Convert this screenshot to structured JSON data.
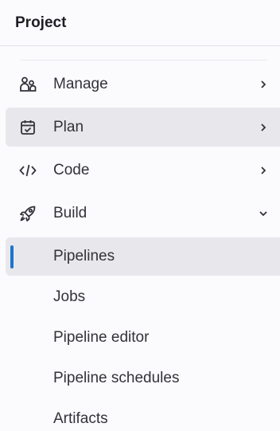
{
  "section": {
    "title": "Project"
  },
  "nav": {
    "items": [
      {
        "label": "Manage",
        "icon": "users-icon",
        "expanded": false
      },
      {
        "label": "Plan",
        "icon": "calendar-check-icon",
        "expanded": false
      },
      {
        "label": "Code",
        "icon": "code-icon",
        "expanded": false
      },
      {
        "label": "Build",
        "icon": "rocket-icon",
        "expanded": true
      }
    ],
    "build_subitems": [
      {
        "label": "Pipelines"
      },
      {
        "label": "Jobs"
      },
      {
        "label": "Pipeline editor"
      },
      {
        "label": "Pipeline schedules"
      },
      {
        "label": "Artifacts"
      }
    ]
  },
  "colors": {
    "active_bg": "#e8e7ec",
    "current_indicator": "#1f75cb",
    "text": "#333238"
  }
}
